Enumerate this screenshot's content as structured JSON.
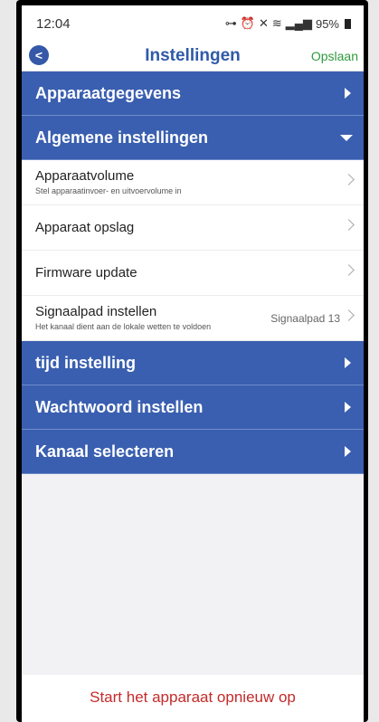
{
  "status_bar": {
    "time": "12:04",
    "icons": [
      "link-icon",
      "alarm-icon",
      "mute-icon",
      "wifi-icon",
      "wifi-call-icon",
      "signal-icon"
    ],
    "battery": "95%"
  },
  "nav": {
    "title": "Instellingen",
    "save_label": "Opslaan",
    "back_glyph": "<"
  },
  "sections": {
    "device_info": "Apparaatgegevens",
    "general": "Algemene instellingen",
    "time": "tijd instelling",
    "password": "Wachtwoord instellen",
    "channel": "Kanaal selecteren"
  },
  "general_items": {
    "volume": {
      "title": "Apparaatvolume",
      "subtitle": "Stel apparaatinvoer- en uitvoervolume in"
    },
    "storage": {
      "title": "Apparaat opslag"
    },
    "firmware": {
      "title": "Firmware update"
    },
    "signal": {
      "title": "Signaalpad instellen",
      "subtitle": "Het kanaal dient aan de lokale wetten te voldoen",
      "value": "Signaalpad 13"
    }
  },
  "footer": {
    "restart_label": "Start het apparaat opnieuw op"
  },
  "colors": {
    "header_blue": "#3a5fb0",
    "title_blue": "#2f5aa8",
    "save_green": "#2e9a3c",
    "restart_red": "#c42a2a"
  }
}
